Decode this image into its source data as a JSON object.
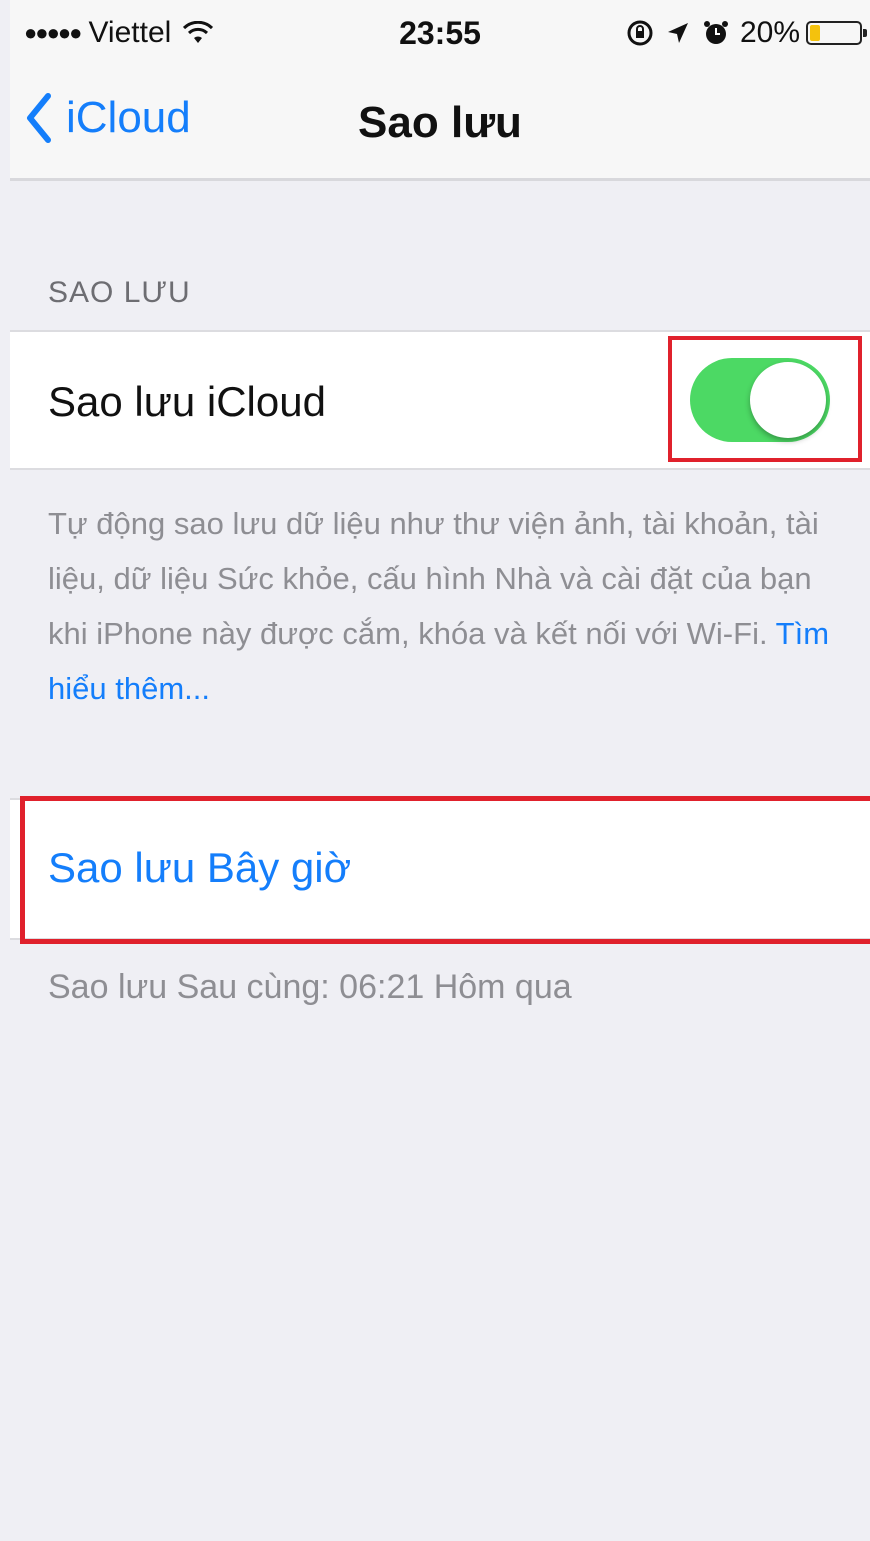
{
  "status_bar": {
    "signal_dots": "●●●●●",
    "carrier": "Viettel",
    "time": "23:55",
    "battery_percent": "20%",
    "battery_level": 0.2,
    "icons": [
      "wifi-icon",
      "rotation-lock-icon",
      "location-icon",
      "alarm-icon",
      "battery-icon"
    ]
  },
  "nav": {
    "back_label": "iCloud",
    "title": "Sao lưu"
  },
  "backup_section": {
    "header": "SAO LƯU",
    "icloud_backup_label": "Sao lưu iCloud",
    "icloud_backup_enabled": true,
    "description": "Tự động sao lưu dữ liệu như thư viện ảnh, tài khoản, tài liệu, dữ liệu Sức khỏe, cấu hình Nhà và cài đặt của bạn khi iPhone này được cắm, khóa và kết nối với Wi-Fi.",
    "learn_more": "Tìm hiểu thêm..."
  },
  "backup_now": {
    "label": "Sao lưu Bây giờ",
    "last_backup": "Sao lưu Sau cùng: 06:21 Hôm qua"
  },
  "colors": {
    "accent": "#147efb",
    "toggle_on": "#4cd964",
    "highlight": "#e0212c",
    "background": "#efeff4"
  }
}
